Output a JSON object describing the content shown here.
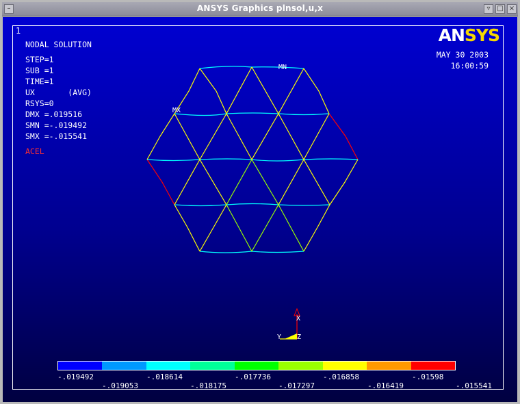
{
  "window": {
    "title": "ANSYS Graphics     plnsol,u,x",
    "menu_icon": "window-menu-icon",
    "controls": [
      "minimize-icon",
      "maximize-icon",
      "close-icon"
    ]
  },
  "viewport": {
    "window_number": "1",
    "logo": {
      "an": "AN",
      "sys": "SYS"
    },
    "date": "MAY 30 2003",
    "time": "16:00:59",
    "result_type": "NODAL SOLUTION",
    "info_lines": [
      "STEP=1",
      "SUB =1",
      "TIME=1",
      "UX       (AVG)",
      "RSYS=0",
      "DMX =.019516",
      "SMN =-.019492",
      "SMX =-.015541"
    ],
    "load_label": "ACEL",
    "mx_label": "MX",
    "mn_label": "MN",
    "triad": {
      "y": "Y",
      "z": "Z",
      "x": "X"
    }
  },
  "colors": {
    "background_top": "#0000d2",
    "background_bottom": "#000040",
    "logo_sys": "#f5d800",
    "load_label": "#ff3030"
  },
  "contour_legend": {
    "colors": [
      "#0000ff",
      "#0099ff",
      "#00ffff",
      "#00ff99",
      "#00ff00",
      "#99ff00",
      "#ffff00",
      "#ff9900",
      "#ff0000"
    ],
    "labels_top": [
      "-.019492",
      "-.018614",
      "-.017736",
      "-.016858",
      "-.01598"
    ],
    "labels_bottom": [
      "-.019053",
      "-.018175",
      "-.017297",
      "-.016419",
      "-.015541"
    ]
  }
}
